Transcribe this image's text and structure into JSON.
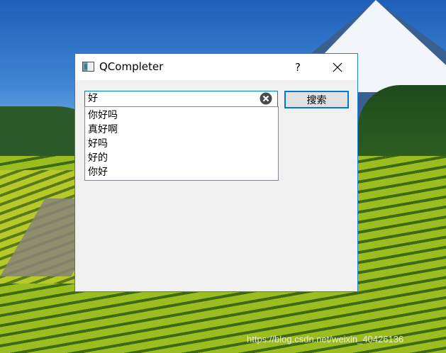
{
  "window": {
    "title": "QCompleter",
    "help_label": "?"
  },
  "search": {
    "value": "好",
    "button_label": "搜索"
  },
  "completer": {
    "items": [
      "你好吗",
      "真好啊",
      "好吗",
      "好的",
      "你好"
    ]
  },
  "desktop": {
    "watermark": "https://blog.csdn.net/weixin_40426136"
  },
  "colors": {
    "accent": "#0078d7",
    "window_border": "#1883d7",
    "client_bg": "#f0f0f0"
  },
  "icons": {
    "app": "app-window-icon",
    "close": "close-icon",
    "clear": "clear-circle-icon"
  }
}
